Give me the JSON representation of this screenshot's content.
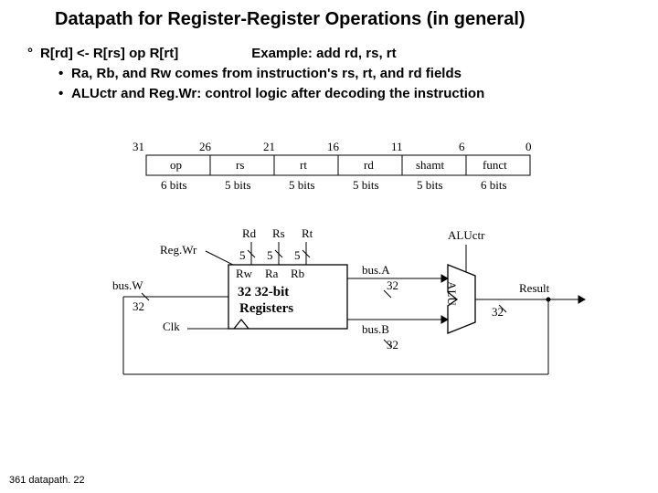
{
  "title": "Datapath for Register-Register Operations (in general)",
  "bullets": {
    "main_l": "R[rd] <- R[rs] op R[rt]",
    "main_r": "Example: add    rd, rs, rt",
    "sub1": "Ra, Rb, and Rw comes from instruction's rs, rt, and rd fields",
    "sub2": "ALUctr and Reg.Wr: control logic after decoding the instruction"
  },
  "format": {
    "ticks": [
      "31",
      "26",
      "21",
      "16",
      "11",
      "6",
      "0"
    ],
    "fields": [
      "op",
      "rs",
      "rt",
      "rd",
      "shamt",
      "funct"
    ],
    "widths": [
      "6 bits",
      "5 bits",
      "5 bits",
      "5 bits",
      "5 bits",
      "6 bits"
    ]
  },
  "dp": {
    "ports_top": [
      "Rd",
      "Rs",
      "Rt"
    ],
    "ports_w": [
      "5",
      "5",
      "5"
    ],
    "regwr": "Reg.Wr",
    "rw_ra_rb": [
      "Rw",
      "Ra",
      "Rb"
    ],
    "regfile_t": "32 32-bit",
    "regfile_b": "Registers",
    "busW": "bus.W",
    "w32": "32",
    "clk": "Clk",
    "busA": "bus.A",
    "a32": "32",
    "busB": "bus.B",
    "b32": "32",
    "aluctr": "ALUctr",
    "alu": "ALU",
    "result": "Result",
    "r32": "32"
  },
  "footer": "361 datapath. 22"
}
